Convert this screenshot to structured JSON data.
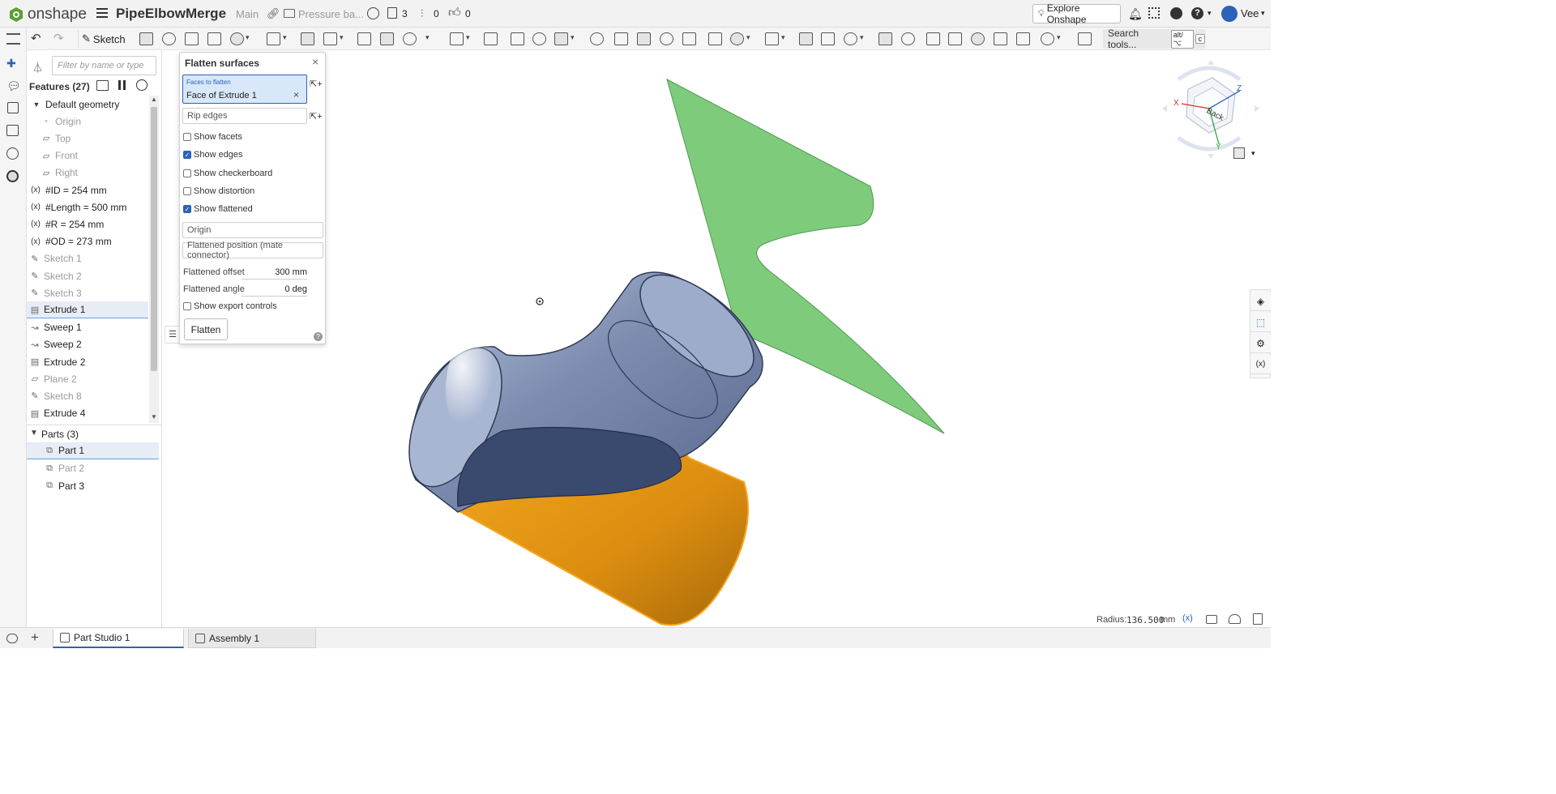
{
  "topbar": {
    "logo_text": "onshape",
    "doc_title": "PipeElbowMerge",
    "branch": "Main",
    "folder": "Pressure ba...",
    "versions_count": "3",
    "instances_count": "0",
    "likes_count": "0",
    "explore_label": "Explore Onshape",
    "user_name": "Vee",
    "brand_color": "#5a9e2f"
  },
  "toolbar": {
    "sketch_label": "Sketch",
    "search_label": "Search tools...",
    "search_shortcut": "alt/⌥",
    "search_shortcut_key": "c"
  },
  "feature_panel": {
    "filter_placeholder": "Filter by name or type",
    "features_header": "Features (27)",
    "items": [
      {
        "label": "Default geometry",
        "icon": "chevron-down-icon"
      },
      {
        "label": "Origin",
        "icon": "origin-icon"
      },
      {
        "label": "Top",
        "icon": "plane-icon"
      },
      {
        "label": "Front",
        "icon": "plane-icon"
      },
      {
        "label": "Right",
        "icon": "plane-icon"
      },
      {
        "label": "#ID = 254 mm",
        "icon": "variable-icon"
      },
      {
        "label": "#Length = 500 mm",
        "icon": "variable-icon"
      },
      {
        "label": "#R = 254 mm",
        "icon": "variable-icon"
      },
      {
        "label": "#OD = 273 mm",
        "icon": "variable-icon"
      },
      {
        "label": "Sketch 1",
        "icon": "sketch-icon"
      },
      {
        "label": "Sketch 2",
        "icon": "sketch-icon"
      },
      {
        "label": "Sketch 3",
        "icon": "sketch-icon"
      },
      {
        "label": "Extrude 1",
        "icon": "extrude-icon"
      },
      {
        "label": "Sweep 1",
        "icon": "sweep-icon"
      },
      {
        "label": "Sweep 2",
        "icon": "sweep-icon"
      },
      {
        "label": "Extrude 2",
        "icon": "extrude-icon"
      },
      {
        "label": "Plane 2",
        "icon": "plane-icon"
      },
      {
        "label": "Sketch 8",
        "icon": "sketch-icon"
      },
      {
        "label": "Extrude 4",
        "icon": "extrude-icon"
      }
    ],
    "parts_header": "Parts (3)",
    "parts": [
      {
        "label": "Part 1"
      },
      {
        "label": "Part 2"
      },
      {
        "label": "Part 3"
      }
    ]
  },
  "dialog": {
    "title": "Flatten surfaces",
    "faces_label": "Faces to flatten",
    "faces_value": "Face of Extrude 1",
    "rip_edges_placeholder": "Rip edges",
    "checkboxes": [
      {
        "label": "Show facets",
        "checked": false
      },
      {
        "label": "Show edges",
        "checked": true
      },
      {
        "label": "Show checkerboard",
        "checked": false
      },
      {
        "label": "Show distortion",
        "checked": false
      },
      {
        "label": "Show flattened",
        "checked": true
      }
    ],
    "origin_field": "Origin",
    "position_field": "Flattened position (mate connector)",
    "offset_label": "Flattened offset",
    "offset_value": "300 mm",
    "angle_label": "Flattened angle",
    "angle_value": "0 deg",
    "export_label": "Show export controls",
    "flatten_button": "Flatten"
  },
  "viewcube": {
    "face_label": "Back",
    "axis_x": "X",
    "axis_y": "Y",
    "axis_z": "Z"
  },
  "status": {
    "radius_label": "Radius:",
    "radius_value": "136.500",
    "radius_unit": "mm"
  },
  "tabs": [
    {
      "label": "Part Studio 1",
      "active": true
    },
    {
      "label": "Assembly 1",
      "active": false
    }
  ],
  "colors": {
    "accent": "#2b63b7",
    "pipe": "#7e8dad",
    "flattened": "#7dcb7b",
    "selected_face": "#f0a31b"
  }
}
